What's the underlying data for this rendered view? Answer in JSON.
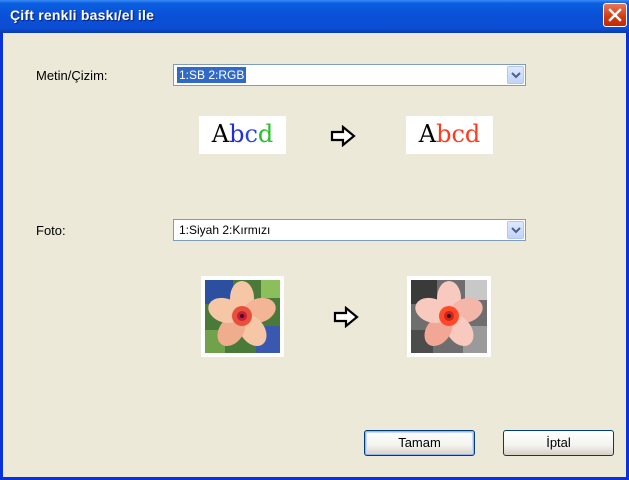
{
  "window": {
    "title": "Çift renkli baskı/el ile"
  },
  "text_drawing": {
    "label": "Metin/Çizim:",
    "selected": "1:SB 2:RGB",
    "sample_before": [
      "A",
      "b",
      "c",
      "d"
    ],
    "sample_after": [
      "A",
      "b",
      "c",
      "d"
    ]
  },
  "photo": {
    "label": "Foto:",
    "selected": "1:Siyah 2:Kırmızı"
  },
  "buttons": {
    "ok": "Tamam",
    "cancel": "İptal"
  },
  "colors": {
    "title_bar": "#0a50d8",
    "close": "#d2380f",
    "selection": "#316ac5",
    "before_letters": [
      "#000000",
      "#1f2fd8",
      "#2a44e0",
      "#22c322"
    ],
    "after_letters": [
      "#000000",
      "#ff3a1a",
      "#ff3a1a",
      "#ff3a1a"
    ]
  }
}
